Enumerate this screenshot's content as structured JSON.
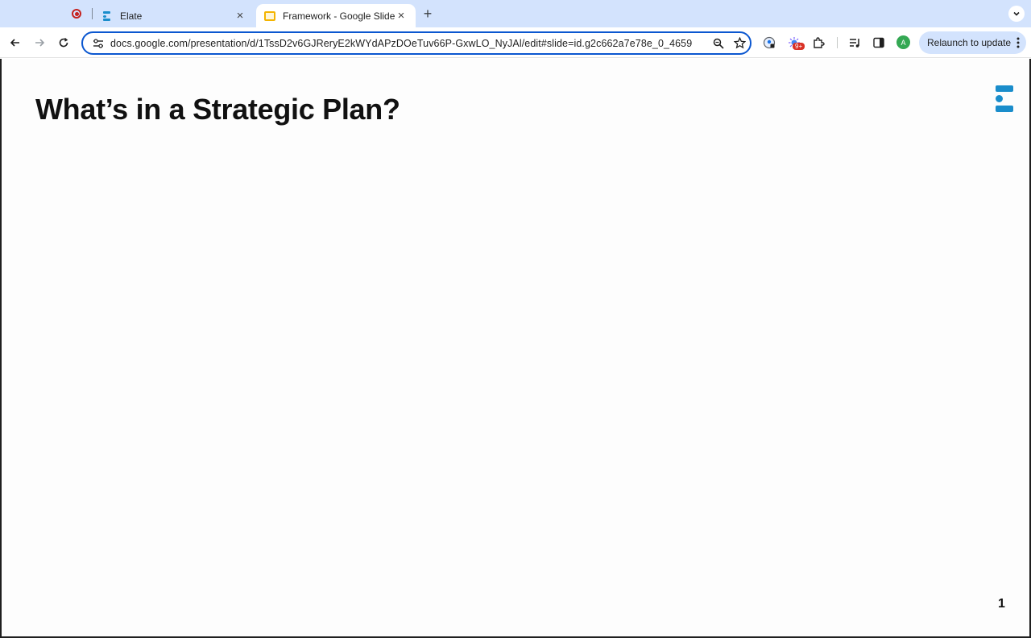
{
  "browser": {
    "tabs": [
      {
        "title": "Elate",
        "favicon": "elate-logo-icon"
      },
      {
        "title": "Framework - Google Slides",
        "favicon": "google-slides-icon",
        "active": true
      }
    ],
    "url": "docs.google.com/presentation/d/1TssD2v6GJReryE2kWYdAPzDOeTuv66P-GxwLO_NyJAl/edit#slide=id.g2c662a7e78e_0_4659",
    "extension_badge": "9+",
    "profile_initial": "A",
    "relaunch_label": "Relaunch to update"
  },
  "slide": {
    "title": "What’s in a Strategic Plan?",
    "page_number": "1",
    "logo": "elate-logo-icon"
  },
  "colors": {
    "accent": "#1a8dcb",
    "tabstrip": "#d3e3fd",
    "omnibox_border": "#0b57d0"
  }
}
